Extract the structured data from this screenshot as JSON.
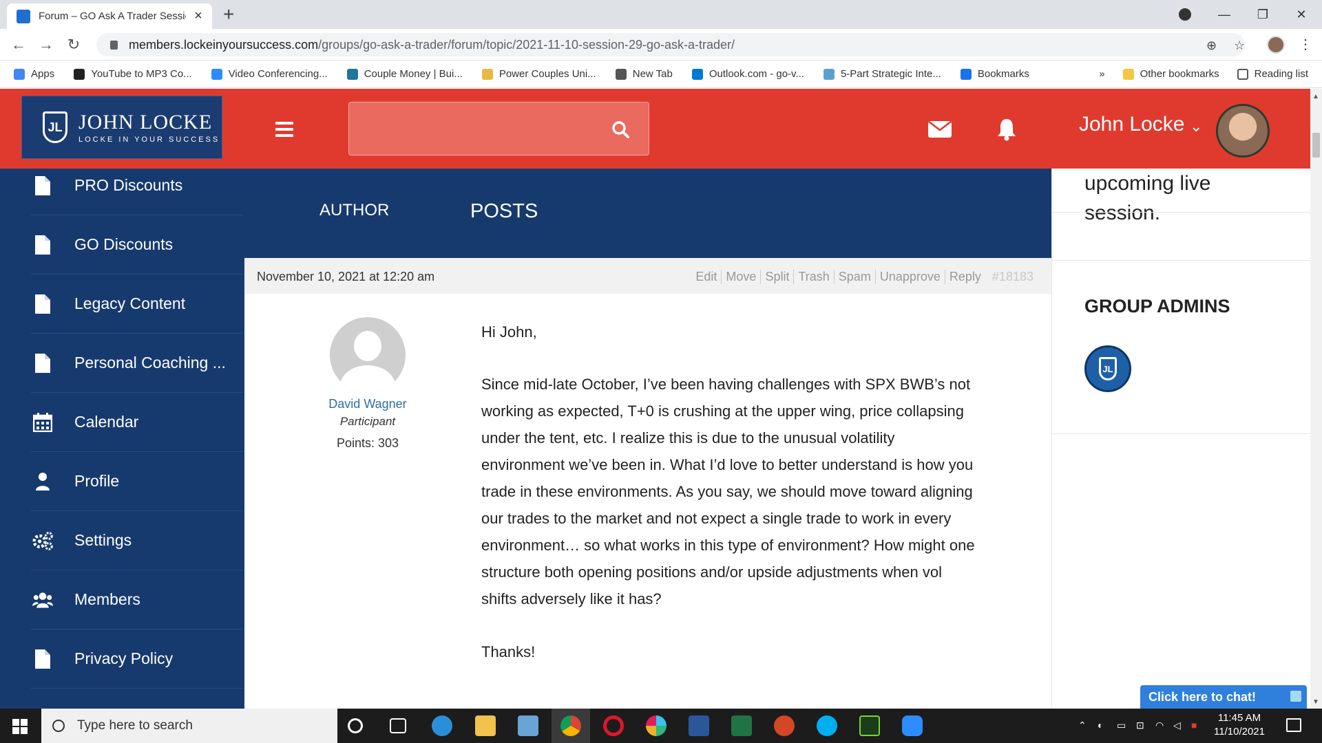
{
  "browser": {
    "tab_title": "Forum – GO Ask A Trader Session",
    "url_host": "members.lockeinyoursuccess.com",
    "url_path": "/groups/go-ask-a-trader/forum/topic/2021-11-10-session-29-go-ask-a-trader/",
    "bookmarks": [
      {
        "label": "Apps",
        "color": "#4285f4"
      },
      {
        "label": "YouTube to MP3 Co...",
        "color": "#222222"
      },
      {
        "label": "Video Conferencing...",
        "color": "#2d8cff"
      },
      {
        "label": "Couple Money | Bui...",
        "color": "#21759b"
      },
      {
        "label": "Power Couples Uni...",
        "color": "#e8b842"
      },
      {
        "label": "New Tab",
        "color": "#555555"
      },
      {
        "label": "Outlook.com - go-v...",
        "color": "#0078d4"
      },
      {
        "label": "5-Part Strategic Inte...",
        "color": "#5ca0d0"
      },
      {
        "label": "Bookmarks",
        "color": "#1a73e8"
      }
    ],
    "more_label": "»",
    "other_bookmarks": "Other bookmarks",
    "reading_list": "Reading list"
  },
  "header": {
    "logo_title": "JOHN LOCKE",
    "logo_tagline": "LOCKE IN YOUR SUCCESS",
    "user_name": "John Locke",
    "accent": "#e03a2f"
  },
  "sidebar": {
    "items": [
      {
        "label": "PRO Discounts",
        "icon": "document-icon"
      },
      {
        "label": "GO Discounts",
        "icon": "document-icon"
      },
      {
        "label": "Legacy Content",
        "icon": "document-icon"
      },
      {
        "label": "Personal Coaching ...",
        "icon": "document-icon"
      },
      {
        "label": "Calendar",
        "icon": "calendar-icon"
      },
      {
        "label": "Profile",
        "icon": "person-icon"
      },
      {
        "label": "Settings",
        "icon": "gears-icon"
      },
      {
        "label": "Members",
        "icon": "group-icon"
      },
      {
        "label": "Privacy Policy",
        "icon": "document-icon"
      }
    ]
  },
  "forum": {
    "col_author": "AUTHOR",
    "col_posts": "POSTS",
    "post": {
      "date": "November 10, 2021 at 12:20 am",
      "actions": [
        "Edit",
        "Move",
        "Split",
        "Trash",
        "Spam",
        "Unapprove",
        "Reply"
      ],
      "post_id": "#18183",
      "author_name": "David Wagner",
      "author_role": "Participant",
      "author_points": "Points: 303",
      "greeting": "Hi John,",
      "body": "Since mid-late October, I’ve been having challenges with SPX BWB’s not working as expected, T+0 is crushing at the upper wing, price collapsing under the tent, etc. I realize this is due to the unusual volatility environment we’ve been in.  What I’d love to better understand is how you trade in these environments.  As you say, we should move toward aligning our trades to the market and not expect a single trade to work in every environment… so what works in this type of environment?  How might one structure both opening positions and/or upside adjustments when vol shifts adversely like it has?",
      "signoff": "Thanks!"
    }
  },
  "right_sidebar": {
    "text": "upcoming live session.",
    "group_admins": "GROUP ADMINS"
  },
  "chat": {
    "label": "Click here to chat!"
  },
  "taskbar": {
    "search_placeholder": "Type here to search",
    "time": "11:45 AM",
    "date": "11/10/2021"
  }
}
